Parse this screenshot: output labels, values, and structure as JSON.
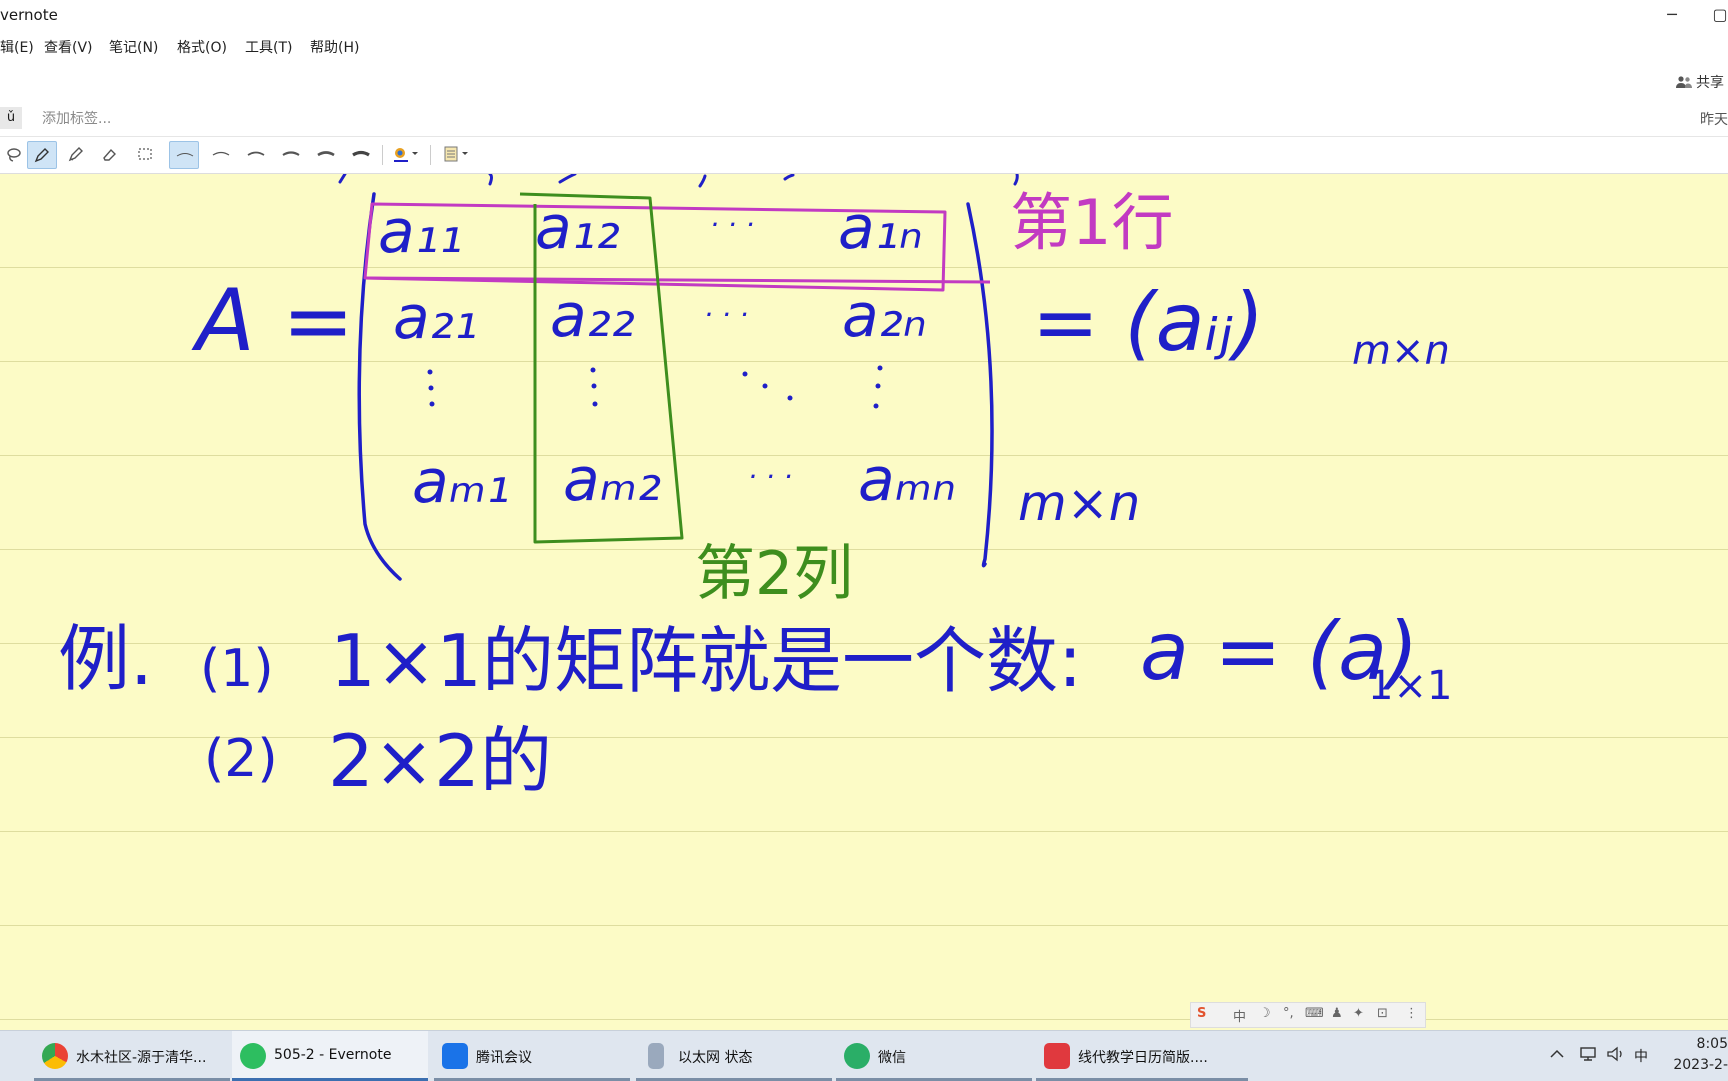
{
  "window": {
    "title": "vernote",
    "min_symbol": "─",
    "max_symbol": "▢"
  },
  "menu": [
    {
      "label": "辑(E)"
    },
    {
      "label": "查看(V)"
    },
    {
      "label": "笔记(N)"
    },
    {
      "label": "格式(O)"
    },
    {
      "label": "工具(T)"
    },
    {
      "label": "帮助(H)"
    }
  ],
  "toolbar": {
    "share_label": "共享"
  },
  "tagbar": {
    "notebook_symbol": "ǔ",
    "tag_placeholder": "添加标签...",
    "date": "昨天"
  },
  "ink_tools": {
    "icons": [
      "lasso-icon",
      "pen-icon",
      "highlighter-icon",
      "eraser-icon",
      "selection-rect-icon",
      "stroke-width-1-icon",
      "stroke-width-2-icon",
      "stroke-width-3-icon",
      "stroke-width-4-icon",
      "stroke-width-5-icon",
      "stroke-width-6-icon",
      "color-picker-icon",
      "paper-style-icon"
    ],
    "active": [
      "pen-icon",
      "stroke-width-1-icon"
    ]
  },
  "note_ink": {
    "matrix_lhs": "A =",
    "row1": [
      "a₁₁",
      "a₁₂",
      "· · ·",
      "a₁ₙ"
    ],
    "row2": [
      "a₂₁",
      "a₂₂",
      "· · ·",
      "a₂ₙ"
    ],
    "row_m": [
      "aₘ₁",
      "aₘ₂",
      "· · ·",
      "aₘₙ"
    ],
    "size_label": "m×n",
    "rhs": "= (aᵢⱼ)",
    "rhs_subscript": "m×n",
    "row_annotation": "第1行",
    "col_annotation": "第2列",
    "example_prefix": "例.",
    "example1_num": "(1)",
    "example1_text": "1×1的矩阵就是一个数:",
    "example1_formula": "a = (a)",
    "example1_subscript": "1×1",
    "example2_num": "(2)",
    "example2_text": "2×2的",
    "colors": {
      "ink": "#1f1fc8",
      "row_highlight": "#c23ac2",
      "col_highlight": "#3e8e1e"
    }
  },
  "ime_bar": {
    "items": [
      "S",
      "中",
      "☽",
      "°,",
      "⌨",
      "♟",
      "✦",
      "⊡",
      "⋮"
    ]
  },
  "taskbar": {
    "tasks": [
      {
        "label": "水木社区-源于清华...",
        "icon": "chrome-icon"
      },
      {
        "label": "505-2 - Evernote",
        "icon": "evernote-icon",
        "active": true
      },
      {
        "label": "腾讯会议",
        "icon": "tencent-meeting-icon"
      },
      {
        "label": "以太网 状态",
        "icon": "network-icon"
      },
      {
        "label": "微信",
        "icon": "wechat-icon"
      },
      {
        "label": "线代教学日历简版....",
        "icon": "wps-icon"
      }
    ],
    "tray": {
      "ime": "中",
      "time": "8:05",
      "date": "2023-2-"
    }
  }
}
